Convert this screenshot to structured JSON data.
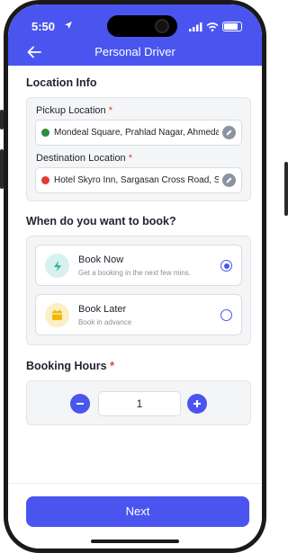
{
  "status_bar": {
    "time": "5:50"
  },
  "header": {
    "title": "Personal Driver",
    "accent_color": "#4a55f0"
  },
  "location_info": {
    "title": "Location Info",
    "pickup": {
      "label": "Pickup Location",
      "required_mark": "*",
      "value": "Mondeal Square, Prahlad Nagar, Ahmeda...",
      "dot_color": "#2e8b3a"
    },
    "destination": {
      "label": "Destination Location",
      "required_mark": "*",
      "value": "Hotel Skyro Inn, Sargasan Cross Road, Sar...",
      "dot_color": "#e53935"
    }
  },
  "booking_time": {
    "title": "When do you want to book?",
    "options": [
      {
        "title": "Book Now",
        "subtitle": "Get a booking in the next few mins.",
        "icon": "flash-icon",
        "selected": true
      },
      {
        "title": "Book Later",
        "subtitle": "Book in advance",
        "icon": "calendar-icon",
        "selected": false
      }
    ]
  },
  "booking_hours": {
    "title": "Booking Hours",
    "required_mark": "*",
    "value": "1"
  },
  "footer": {
    "next_label": "Next"
  }
}
